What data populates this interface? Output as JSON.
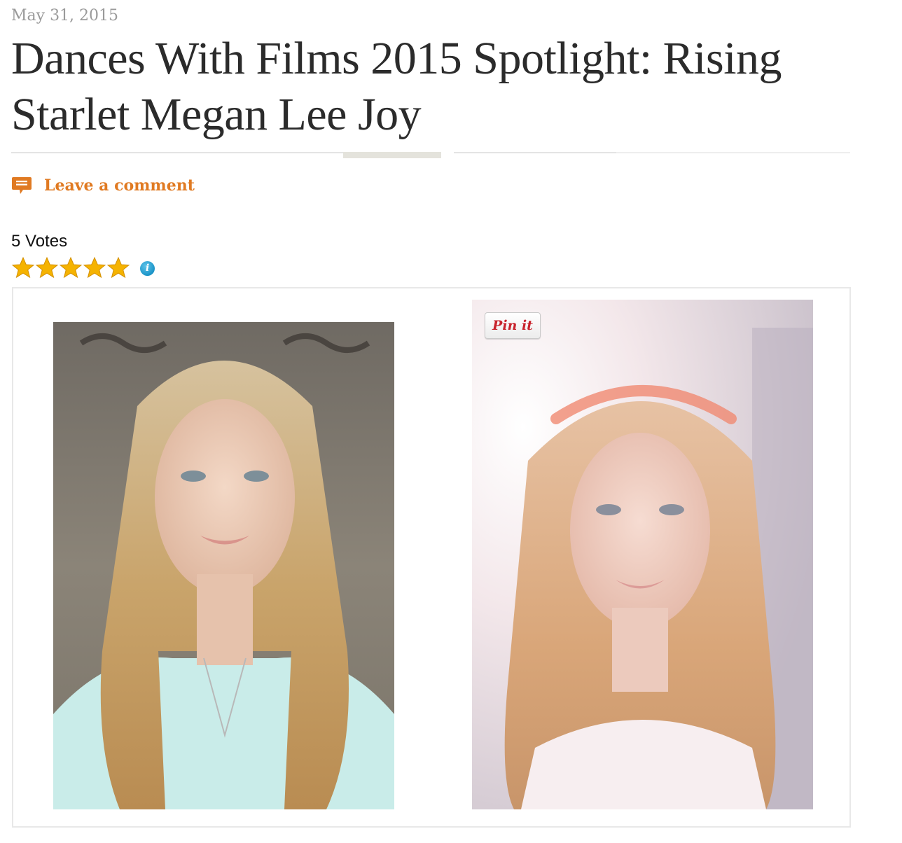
{
  "post": {
    "date": "May 31, 2015",
    "title": "Dances With Films 2015 Spotlight: Rising Starlet Megan Lee Joy",
    "comment_link_label": "Leave a comment"
  },
  "rating": {
    "votes_text": "5 Votes",
    "stars": 5,
    "max_stars": 5
  },
  "gallery": {
    "photos": [
      {
        "subject": "portrait-blonde-woman-mint-top"
      },
      {
        "subject": "portrait-woman-flower-crown-backlit"
      }
    ],
    "pin_button_label": "Pin it"
  },
  "colors": {
    "accent_orange": "#e07a22",
    "star_gold": "#f5b301",
    "info_blue": "#1a94c8",
    "pinterest_red": "#c8232c"
  },
  "icons": {
    "comment": "speech-bubble-icon",
    "star": "star-icon",
    "info": "info-icon"
  }
}
